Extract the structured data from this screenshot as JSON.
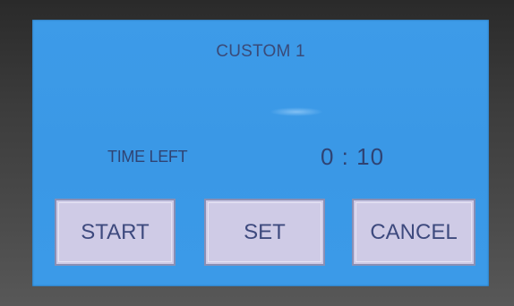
{
  "screen": {
    "title": "CUSTOM 1",
    "time_left_label": "TIME LEFT",
    "time_left_value": "0 : 10"
  },
  "buttons": {
    "start_label": "START",
    "set_label": "SET",
    "cancel_label": "CANCEL"
  },
  "colors": {
    "screen_background": "#3a98e6",
    "text": "#2f4373",
    "button_fill": "#cfcbe6",
    "button_border": "#8a8fb4",
    "bezel": "#3f3f3f"
  }
}
